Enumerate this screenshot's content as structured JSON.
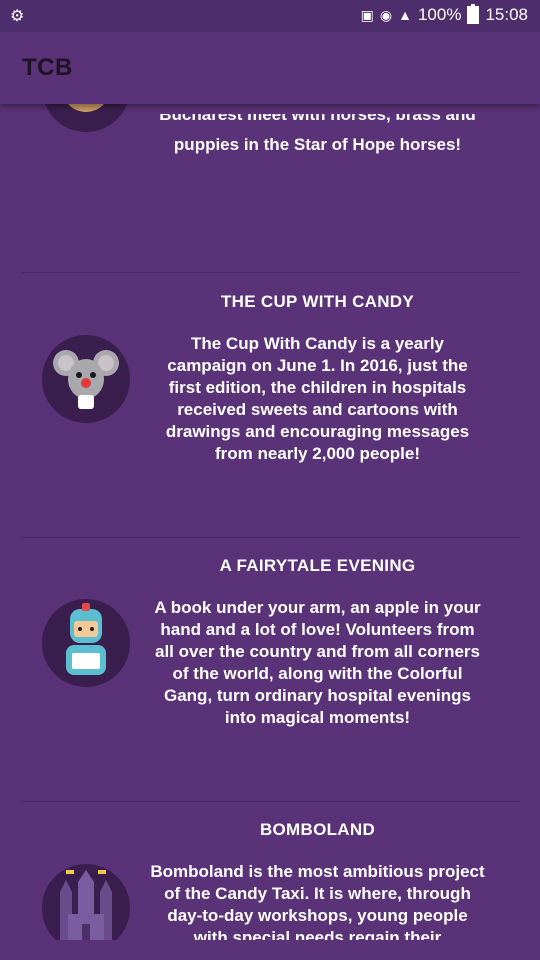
{
  "status_bar": {
    "battery_percent": "100%",
    "time": "15:08",
    "icons": [
      "usb-icon",
      "nfc-icon",
      "wifi-icon",
      "signal-icon",
      "battery-icon"
    ]
  },
  "app": {
    "title": "TCB"
  },
  "items": [
    {
      "title": "",
      "body_line_cut": "Bucharest meet with horses, brass and",
      "body_line_2": "puppies in the Star of Hope horses!"
    },
    {
      "title": "THE CUP WITH CANDY",
      "body": "The Cup With Candy is a yearly campaign on June 1. In 2016, just the first edition, the children in hospitals received sweets and cartoons with drawings and encouraging messages from nearly 2,000 people!"
    },
    {
      "title": "A FAIRYTALE EVENING",
      "body": "A book under your arm, an apple in your hand and a lot of love! Volunteers from all over the country and from all corners of the world, along with the Colorful Gang, turn ordinary hospital evenings into magical moments!"
    },
    {
      "title": "BOMBOLAND",
      "body": "Bomboland is the most ambitious project of the Candy Taxi. It is where, through day-to-day workshops, young people with special needs regain their"
    }
  ]
}
